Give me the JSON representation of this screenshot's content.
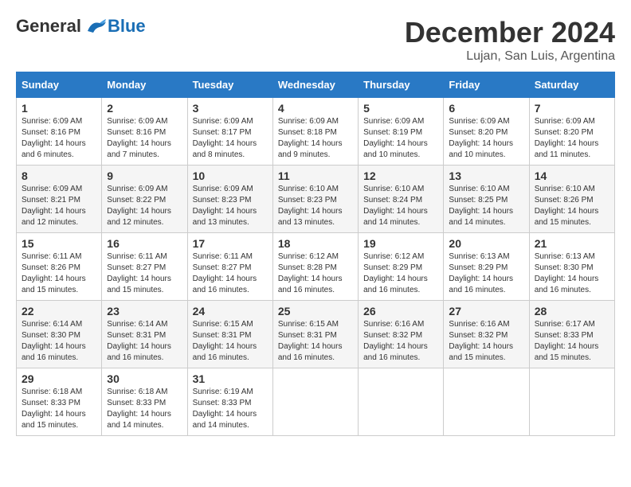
{
  "header": {
    "logo": {
      "general": "General",
      "blue": "Blue"
    },
    "title": "December 2024",
    "location": "Lujan, San Luis, Argentina"
  },
  "days_of_week": [
    "Sunday",
    "Monday",
    "Tuesday",
    "Wednesday",
    "Thursday",
    "Friday",
    "Saturday"
  ],
  "weeks": [
    [
      {
        "day": "1",
        "sunrise": "6:09 AM",
        "sunset": "8:16 PM",
        "daylight": "14 hours and 6 minutes."
      },
      {
        "day": "2",
        "sunrise": "6:09 AM",
        "sunset": "8:16 PM",
        "daylight": "14 hours and 7 minutes."
      },
      {
        "day": "3",
        "sunrise": "6:09 AM",
        "sunset": "8:17 PM",
        "daylight": "14 hours and 8 minutes."
      },
      {
        "day": "4",
        "sunrise": "6:09 AM",
        "sunset": "8:18 PM",
        "daylight": "14 hours and 9 minutes."
      },
      {
        "day": "5",
        "sunrise": "6:09 AM",
        "sunset": "8:19 PM",
        "daylight": "14 hours and 10 minutes."
      },
      {
        "day": "6",
        "sunrise": "6:09 AM",
        "sunset": "8:20 PM",
        "daylight": "14 hours and 10 minutes."
      },
      {
        "day": "7",
        "sunrise": "6:09 AM",
        "sunset": "8:20 PM",
        "daylight": "14 hours and 11 minutes."
      }
    ],
    [
      {
        "day": "8",
        "sunrise": "6:09 AM",
        "sunset": "8:21 PM",
        "daylight": "14 hours and 12 minutes."
      },
      {
        "day": "9",
        "sunrise": "6:09 AM",
        "sunset": "8:22 PM",
        "daylight": "14 hours and 12 minutes."
      },
      {
        "day": "10",
        "sunrise": "6:09 AM",
        "sunset": "8:23 PM",
        "daylight": "14 hours and 13 minutes."
      },
      {
        "day": "11",
        "sunrise": "6:10 AM",
        "sunset": "8:23 PM",
        "daylight": "14 hours and 13 minutes."
      },
      {
        "day": "12",
        "sunrise": "6:10 AM",
        "sunset": "8:24 PM",
        "daylight": "14 hours and 14 minutes."
      },
      {
        "day": "13",
        "sunrise": "6:10 AM",
        "sunset": "8:25 PM",
        "daylight": "14 hours and 14 minutes."
      },
      {
        "day": "14",
        "sunrise": "6:10 AM",
        "sunset": "8:26 PM",
        "daylight": "14 hours and 15 minutes."
      }
    ],
    [
      {
        "day": "15",
        "sunrise": "6:11 AM",
        "sunset": "8:26 PM",
        "daylight": "14 hours and 15 minutes."
      },
      {
        "day": "16",
        "sunrise": "6:11 AM",
        "sunset": "8:27 PM",
        "daylight": "14 hours and 15 minutes."
      },
      {
        "day": "17",
        "sunrise": "6:11 AM",
        "sunset": "8:27 PM",
        "daylight": "14 hours and 16 minutes."
      },
      {
        "day": "18",
        "sunrise": "6:12 AM",
        "sunset": "8:28 PM",
        "daylight": "14 hours and 16 minutes."
      },
      {
        "day": "19",
        "sunrise": "6:12 AM",
        "sunset": "8:29 PM",
        "daylight": "14 hours and 16 minutes."
      },
      {
        "day": "20",
        "sunrise": "6:13 AM",
        "sunset": "8:29 PM",
        "daylight": "14 hours and 16 minutes."
      },
      {
        "day": "21",
        "sunrise": "6:13 AM",
        "sunset": "8:30 PM",
        "daylight": "14 hours and 16 minutes."
      }
    ],
    [
      {
        "day": "22",
        "sunrise": "6:14 AM",
        "sunset": "8:30 PM",
        "daylight": "14 hours and 16 minutes."
      },
      {
        "day": "23",
        "sunrise": "6:14 AM",
        "sunset": "8:31 PM",
        "daylight": "14 hours and 16 minutes."
      },
      {
        "day": "24",
        "sunrise": "6:15 AM",
        "sunset": "8:31 PM",
        "daylight": "14 hours and 16 minutes."
      },
      {
        "day": "25",
        "sunrise": "6:15 AM",
        "sunset": "8:31 PM",
        "daylight": "14 hours and 16 minutes."
      },
      {
        "day": "26",
        "sunrise": "6:16 AM",
        "sunset": "8:32 PM",
        "daylight": "14 hours and 16 minutes."
      },
      {
        "day": "27",
        "sunrise": "6:16 AM",
        "sunset": "8:32 PM",
        "daylight": "14 hours and 15 minutes."
      },
      {
        "day": "28",
        "sunrise": "6:17 AM",
        "sunset": "8:33 PM",
        "daylight": "14 hours and 15 minutes."
      }
    ],
    [
      {
        "day": "29",
        "sunrise": "6:18 AM",
        "sunset": "8:33 PM",
        "daylight": "14 hours and 15 minutes."
      },
      {
        "day": "30",
        "sunrise": "6:18 AM",
        "sunset": "8:33 PM",
        "daylight": "14 hours and 14 minutes."
      },
      {
        "day": "31",
        "sunrise": "6:19 AM",
        "sunset": "8:33 PM",
        "daylight": "14 hours and 14 minutes."
      },
      null,
      null,
      null,
      null
    ]
  ]
}
